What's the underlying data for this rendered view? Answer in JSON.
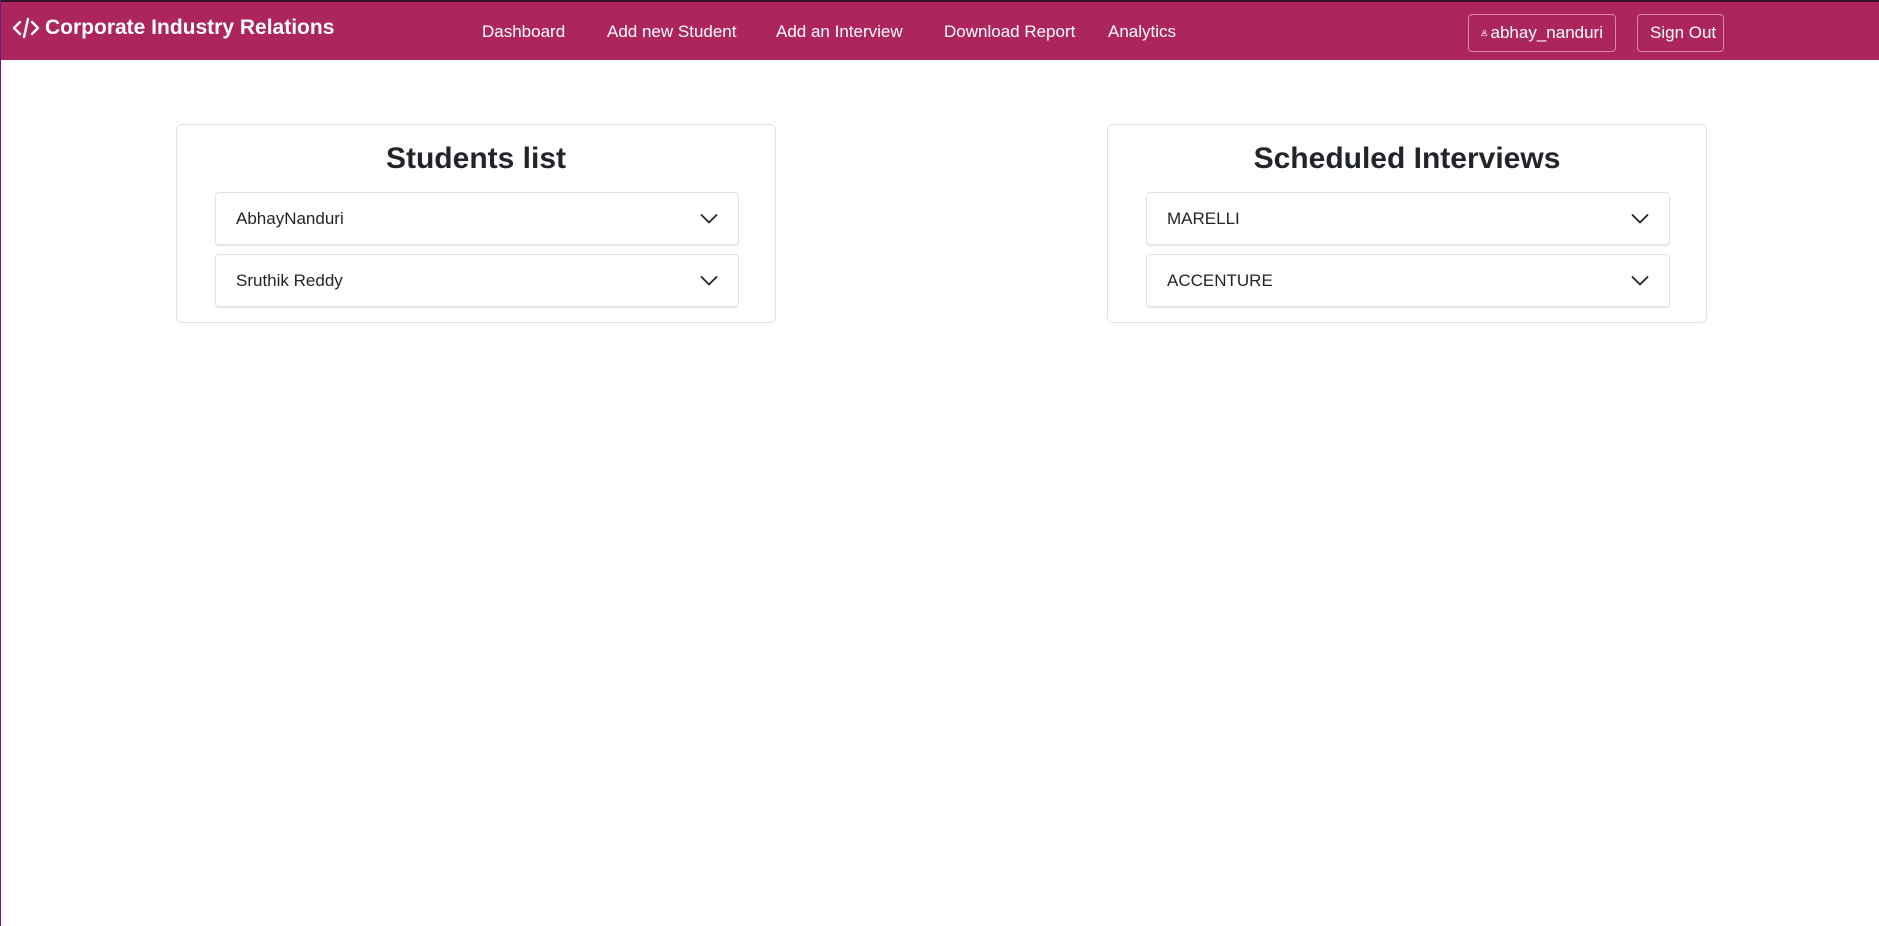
{
  "navbar": {
    "brand": "Corporate Industry Relations",
    "brand_icon": "code-icon",
    "links": [
      "Dashboard",
      "Add new Student",
      "Add an Interview",
      "Download Report",
      "Analytics"
    ],
    "user": "abhay_nanduri",
    "user_icon": "person-icon",
    "signout": "Sign Out",
    "color": "#ad255d"
  },
  "students": {
    "title": "Students list",
    "items": [
      "AbhayNanduri",
      "Sruthik Reddy"
    ]
  },
  "interviews": {
    "title": "Scheduled Interviews",
    "items": [
      "MARELLI",
      "ACCENTURE"
    ]
  }
}
